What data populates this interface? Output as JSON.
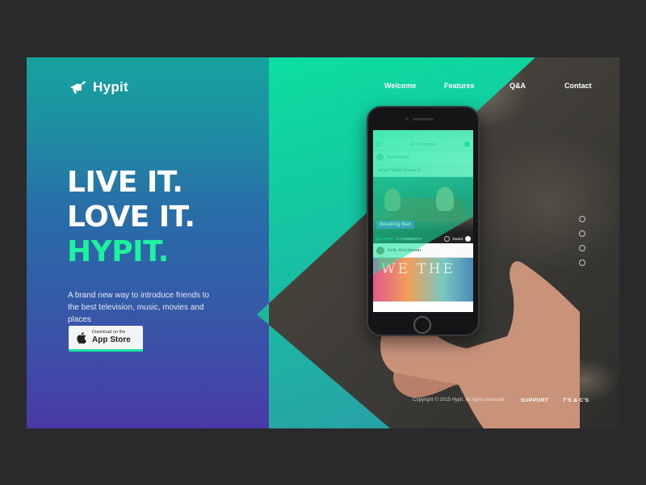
{
  "brand": {
    "name": "Hypit"
  },
  "nav": {
    "items": [
      {
        "label": "Welcome"
      },
      {
        "label": "Features"
      },
      {
        "label": "Q&A"
      },
      {
        "label": "Contact"
      }
    ]
  },
  "hero": {
    "line1": "LIVE IT.",
    "line2": "LOVE IT.",
    "line3": "HYPIT.",
    "tagline": "A brand new way to introduce friends to the best television, music, movies and places"
  },
  "cta": {
    "small": "Download on the",
    "big": "App Store",
    "icon": "apple-icon"
  },
  "pager": {
    "count": 4
  },
  "footer": {
    "copyright": "Copyright © 2015 Hypit. All rights reserved",
    "support": "SUPPORT",
    "terms": "T'S & C'S"
  },
  "phone": {
    "header": "All Categories",
    "row_name": "Rosie Mabel",
    "message": "series! Watch season 3...",
    "show_tag": "Breaking Bad",
    "meta_hypes": "16 HYPES",
    "meta_comments": "/ 5 COMMENTS",
    "meta_saved": "Saved",
    "user": "Kelly Hutchinson",
    "poster_text": "WE THE"
  },
  "colors": {
    "accent_green": "#1df29f",
    "tag_purple": "#7a3ad8",
    "appstore_underline": "#1be39a"
  }
}
